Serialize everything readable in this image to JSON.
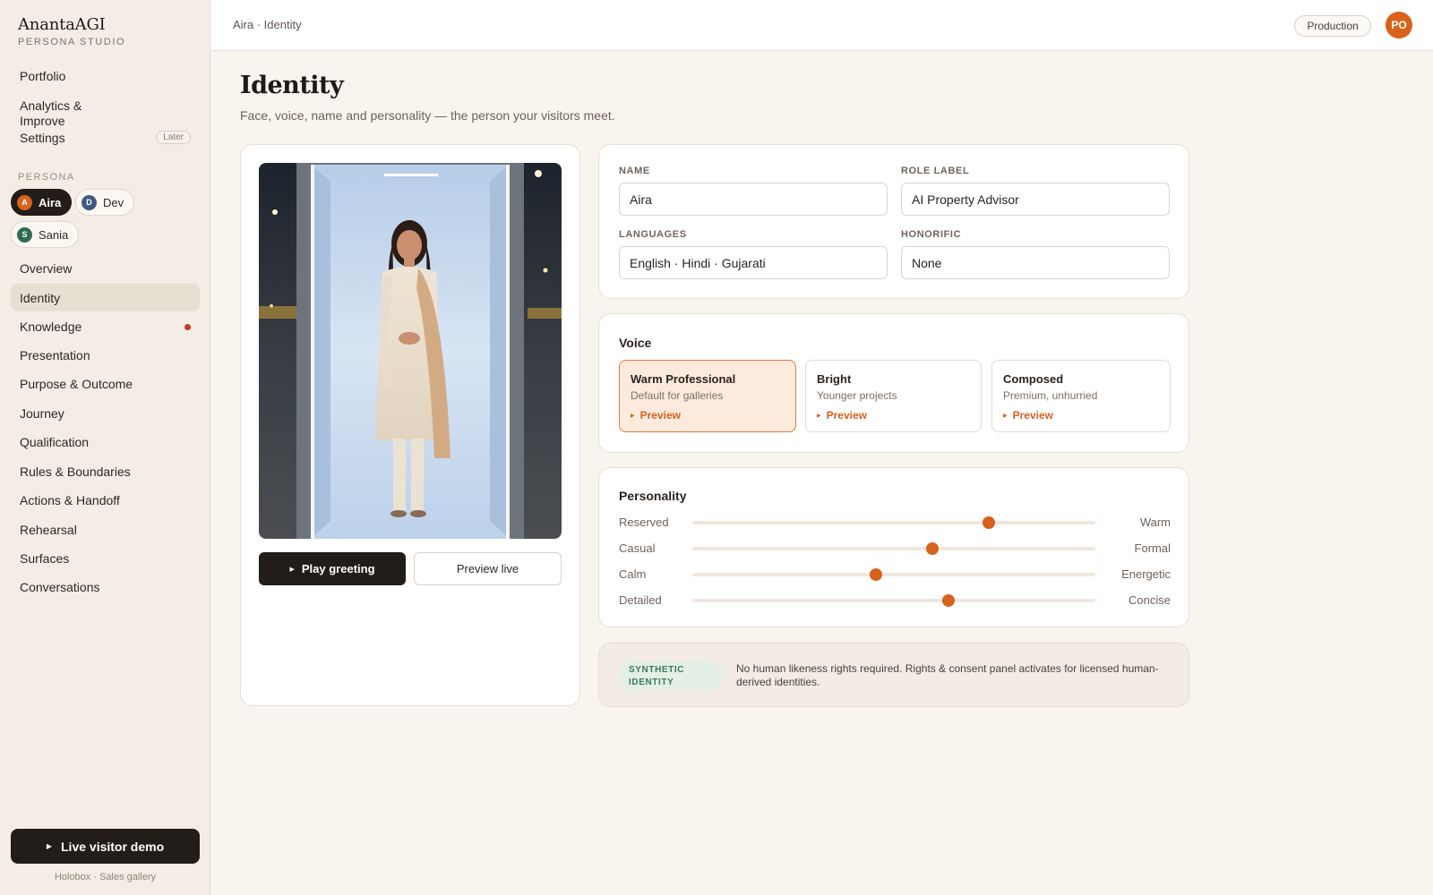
{
  "brand": {
    "name": "AnantaAGI",
    "sub": "PERSONA STUDIO"
  },
  "sidebar": {
    "top_items": [
      {
        "label": "Portfolio"
      },
      {
        "label": "Analytics & Improve"
      },
      {
        "label": "Settings",
        "badge": "Later"
      }
    ],
    "persona_label": "PERSONA",
    "personas": [
      {
        "initial": "A",
        "name": "Aira",
        "color": "#d8611c",
        "active": true
      },
      {
        "initial": "D",
        "name": "Dev",
        "color": "#3f5a82",
        "active": false
      },
      {
        "initial": "S",
        "name": "Sania",
        "color": "#2f6b52",
        "active": false
      }
    ],
    "nav": [
      {
        "label": "Overview"
      },
      {
        "label": "Identity",
        "active": true
      },
      {
        "label": "Knowledge",
        "dot": true
      },
      {
        "label": "Presentation"
      },
      {
        "label": "Purpose & Outcome"
      },
      {
        "label": "Journey"
      },
      {
        "label": "Qualification"
      },
      {
        "label": "Rules & Boundaries"
      },
      {
        "label": "Actions & Handoff"
      },
      {
        "label": "Rehearsal"
      },
      {
        "label": "Surfaces"
      },
      {
        "label": "Conversations"
      }
    ],
    "live_demo": "Live visitor demo",
    "footnote": "Holobox · Sales gallery"
  },
  "topbar": {
    "breadcrumb": "Aira · Identity",
    "environment": "Production",
    "avatar": "PO"
  },
  "page": {
    "title": "Identity",
    "subtitle": "Face, voice, name and personality — the person your visitors meet."
  },
  "preview": {
    "play_label": "Play greeting",
    "live_label": "Preview live"
  },
  "fields": {
    "name": {
      "label": "NAME",
      "value": "Aira"
    },
    "role": {
      "label": "ROLE LABEL",
      "value": "AI Property Advisor"
    },
    "languages": {
      "label": "LANGUAGES",
      "value": "English · Hindi · Gujarati"
    },
    "honorific": {
      "label": "HONORIFIC",
      "value": "None"
    }
  },
  "voice": {
    "title": "Voice",
    "preview_label": "Preview",
    "options": [
      {
        "name": "Warm Professional",
        "desc": "Default for galleries",
        "selected": true
      },
      {
        "name": "Bright",
        "desc": "Younger projects",
        "selected": false
      },
      {
        "name": "Composed",
        "desc": "Premium, unhurried",
        "selected": false
      }
    ]
  },
  "personality": {
    "title": "Personality",
    "sliders": [
      {
        "left": "Reserved",
        "right": "Warm",
        "value": 0.735
      },
      {
        "left": "Casual",
        "right": "Formal",
        "value": 0.595
      },
      {
        "left": "Calm",
        "right": "Energetic",
        "value": 0.455
      },
      {
        "left": "Detailed",
        "right": "Concise",
        "value": 0.635
      }
    ]
  },
  "notice": {
    "badge": "SYNTHETIC IDENTITY",
    "text": "No human likeness rights required. Rights & consent panel activates for licensed human-derived identities."
  },
  "colors": {
    "accent": "#d8611c",
    "dark": "#221d19",
    "background": "#f8f4ee"
  }
}
